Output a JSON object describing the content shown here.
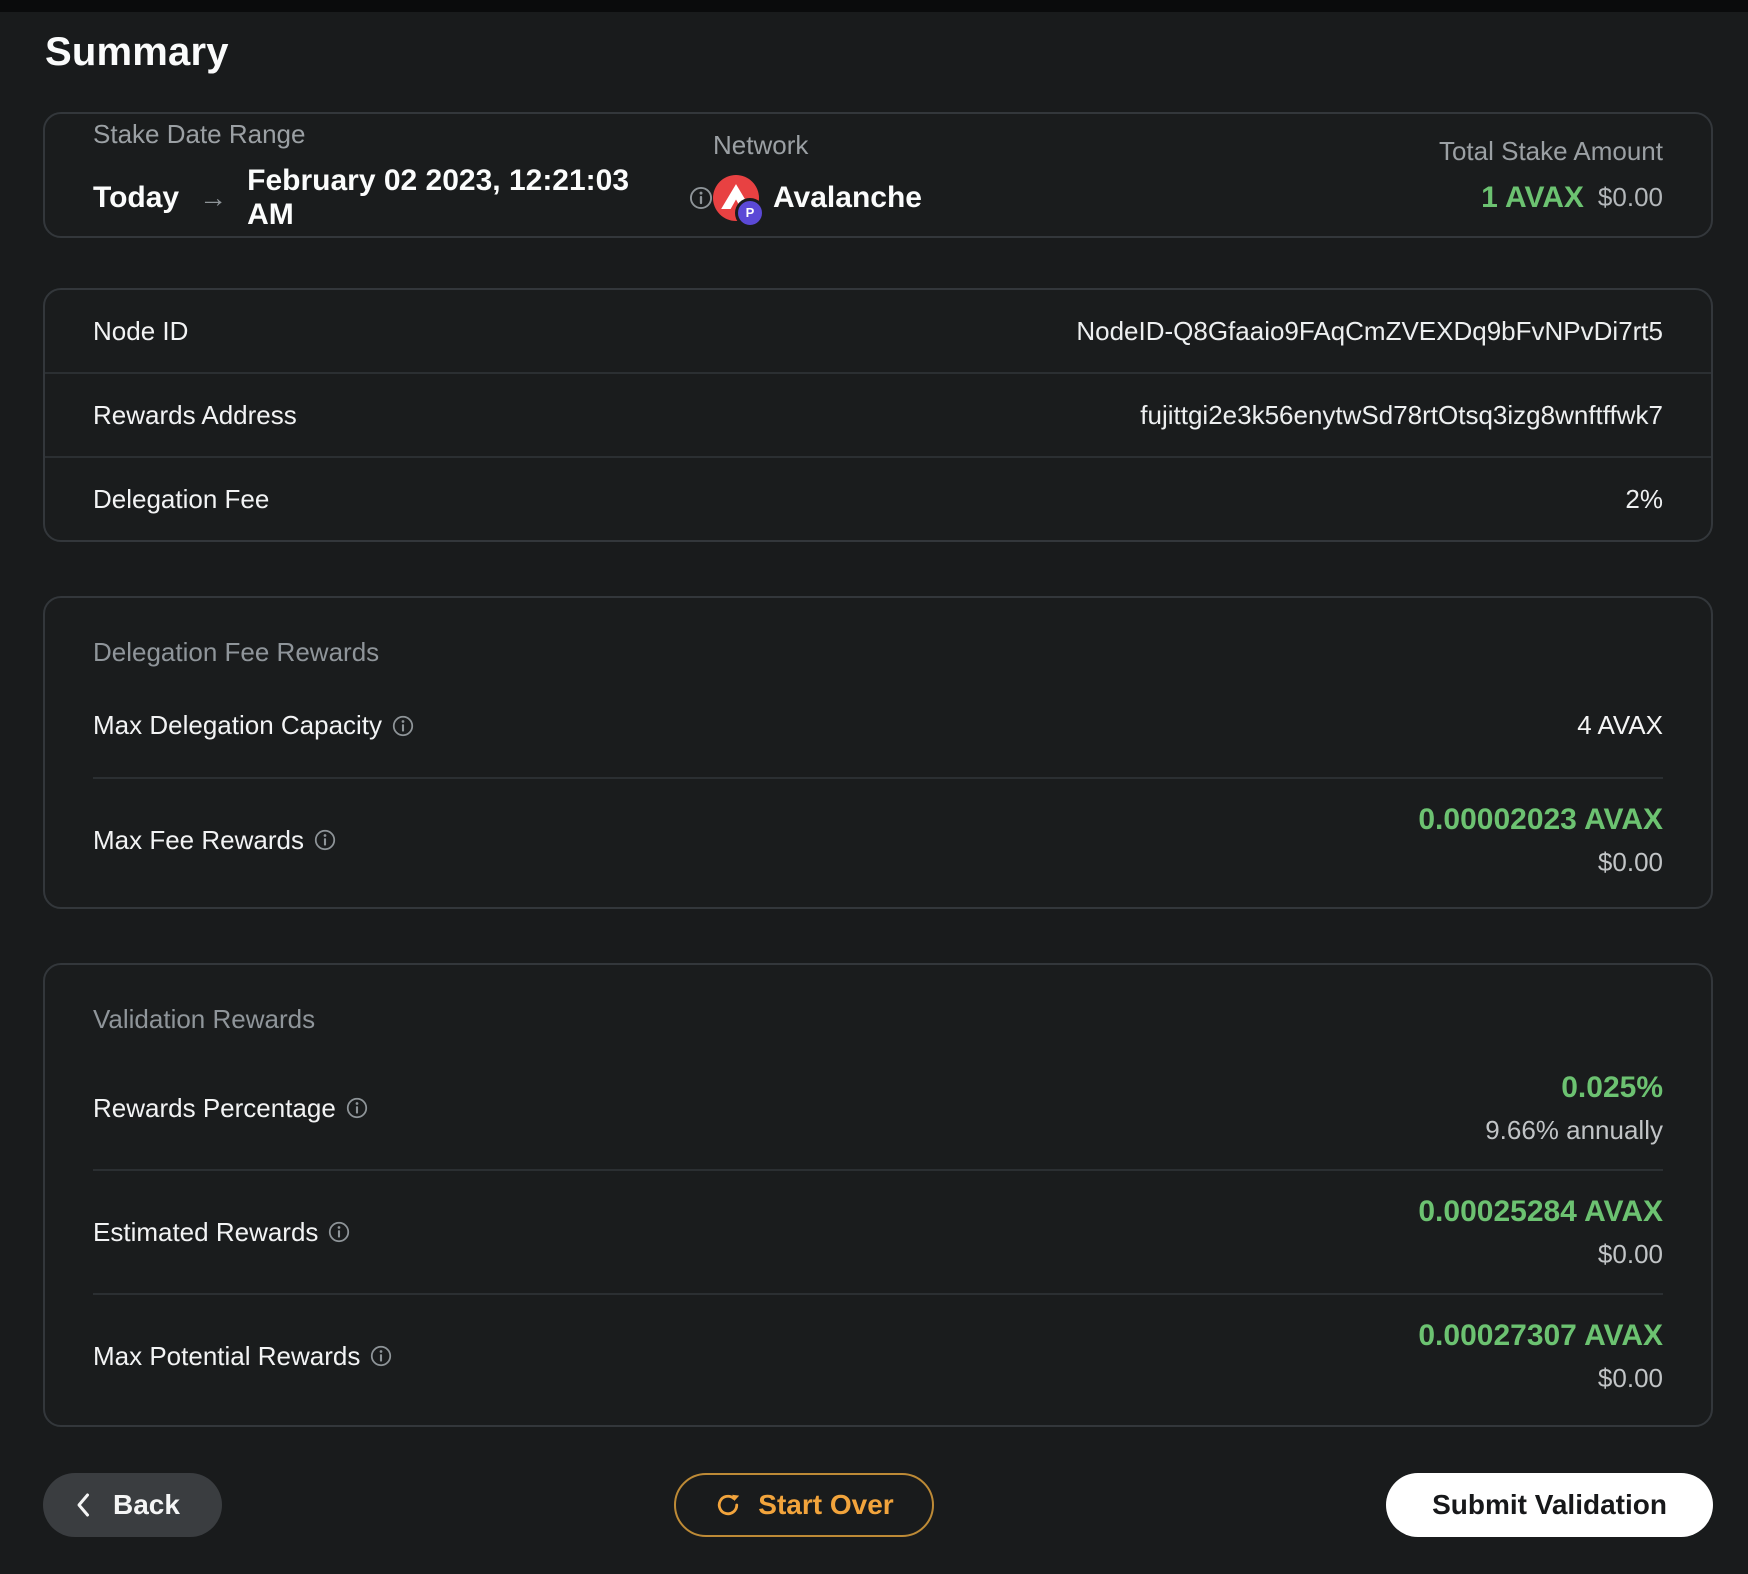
{
  "colors": {
    "accent_green": "#6CC271",
    "accent_orange": "#F2A43C",
    "avalanche_red": "#E84142",
    "p_badge_purple": "#5B49D6",
    "background": "#191B1C"
  },
  "title": "Summary",
  "overview": {
    "stake_date_range": {
      "label": "Stake Date Range",
      "from": "Today",
      "arrow": "→",
      "to": "February 02 2023, 12:21:03 AM"
    },
    "network": {
      "label": "Network",
      "value": "Avalanche",
      "badge": "P"
    },
    "total_stake": {
      "label": "Total Stake Amount",
      "amount": "1 AVAX",
      "usd": "$0.00"
    }
  },
  "node_table": {
    "rows": [
      {
        "label": "Node ID",
        "value": "NodeID-Q8Gfaaio9FAqCmZVEXDq9bFvNPvDi7rt5"
      },
      {
        "label": "Rewards Address",
        "value": "fujittgi2e3k56enytwSd78rtOtsq3izg8wnftffwk7"
      },
      {
        "label": "Delegation Fee",
        "value": "2%"
      }
    ]
  },
  "delegation_fee_rewards": {
    "title": "Delegation Fee Rewards",
    "capacity": {
      "label": "Max Delegation Capacity",
      "value": "4 AVAX"
    },
    "max_fee": {
      "label": "Max Fee Rewards",
      "value": "0.00002023 AVAX",
      "usd": "$0.00"
    }
  },
  "validation_rewards": {
    "title": "Validation Rewards",
    "rows": [
      {
        "label": "Rewards Percentage",
        "value": "0.025%",
        "sub": "9.66% annually"
      },
      {
        "label": "Estimated Rewards",
        "value": "0.00025284 AVAX",
        "sub": "$0.00"
      },
      {
        "label": "Max Potential Rewards",
        "value": "0.00027307 AVAX",
        "sub": "$0.00"
      }
    ]
  },
  "footer": {
    "back": "Back",
    "start_over": "Start Over",
    "submit": "Submit Validation"
  }
}
